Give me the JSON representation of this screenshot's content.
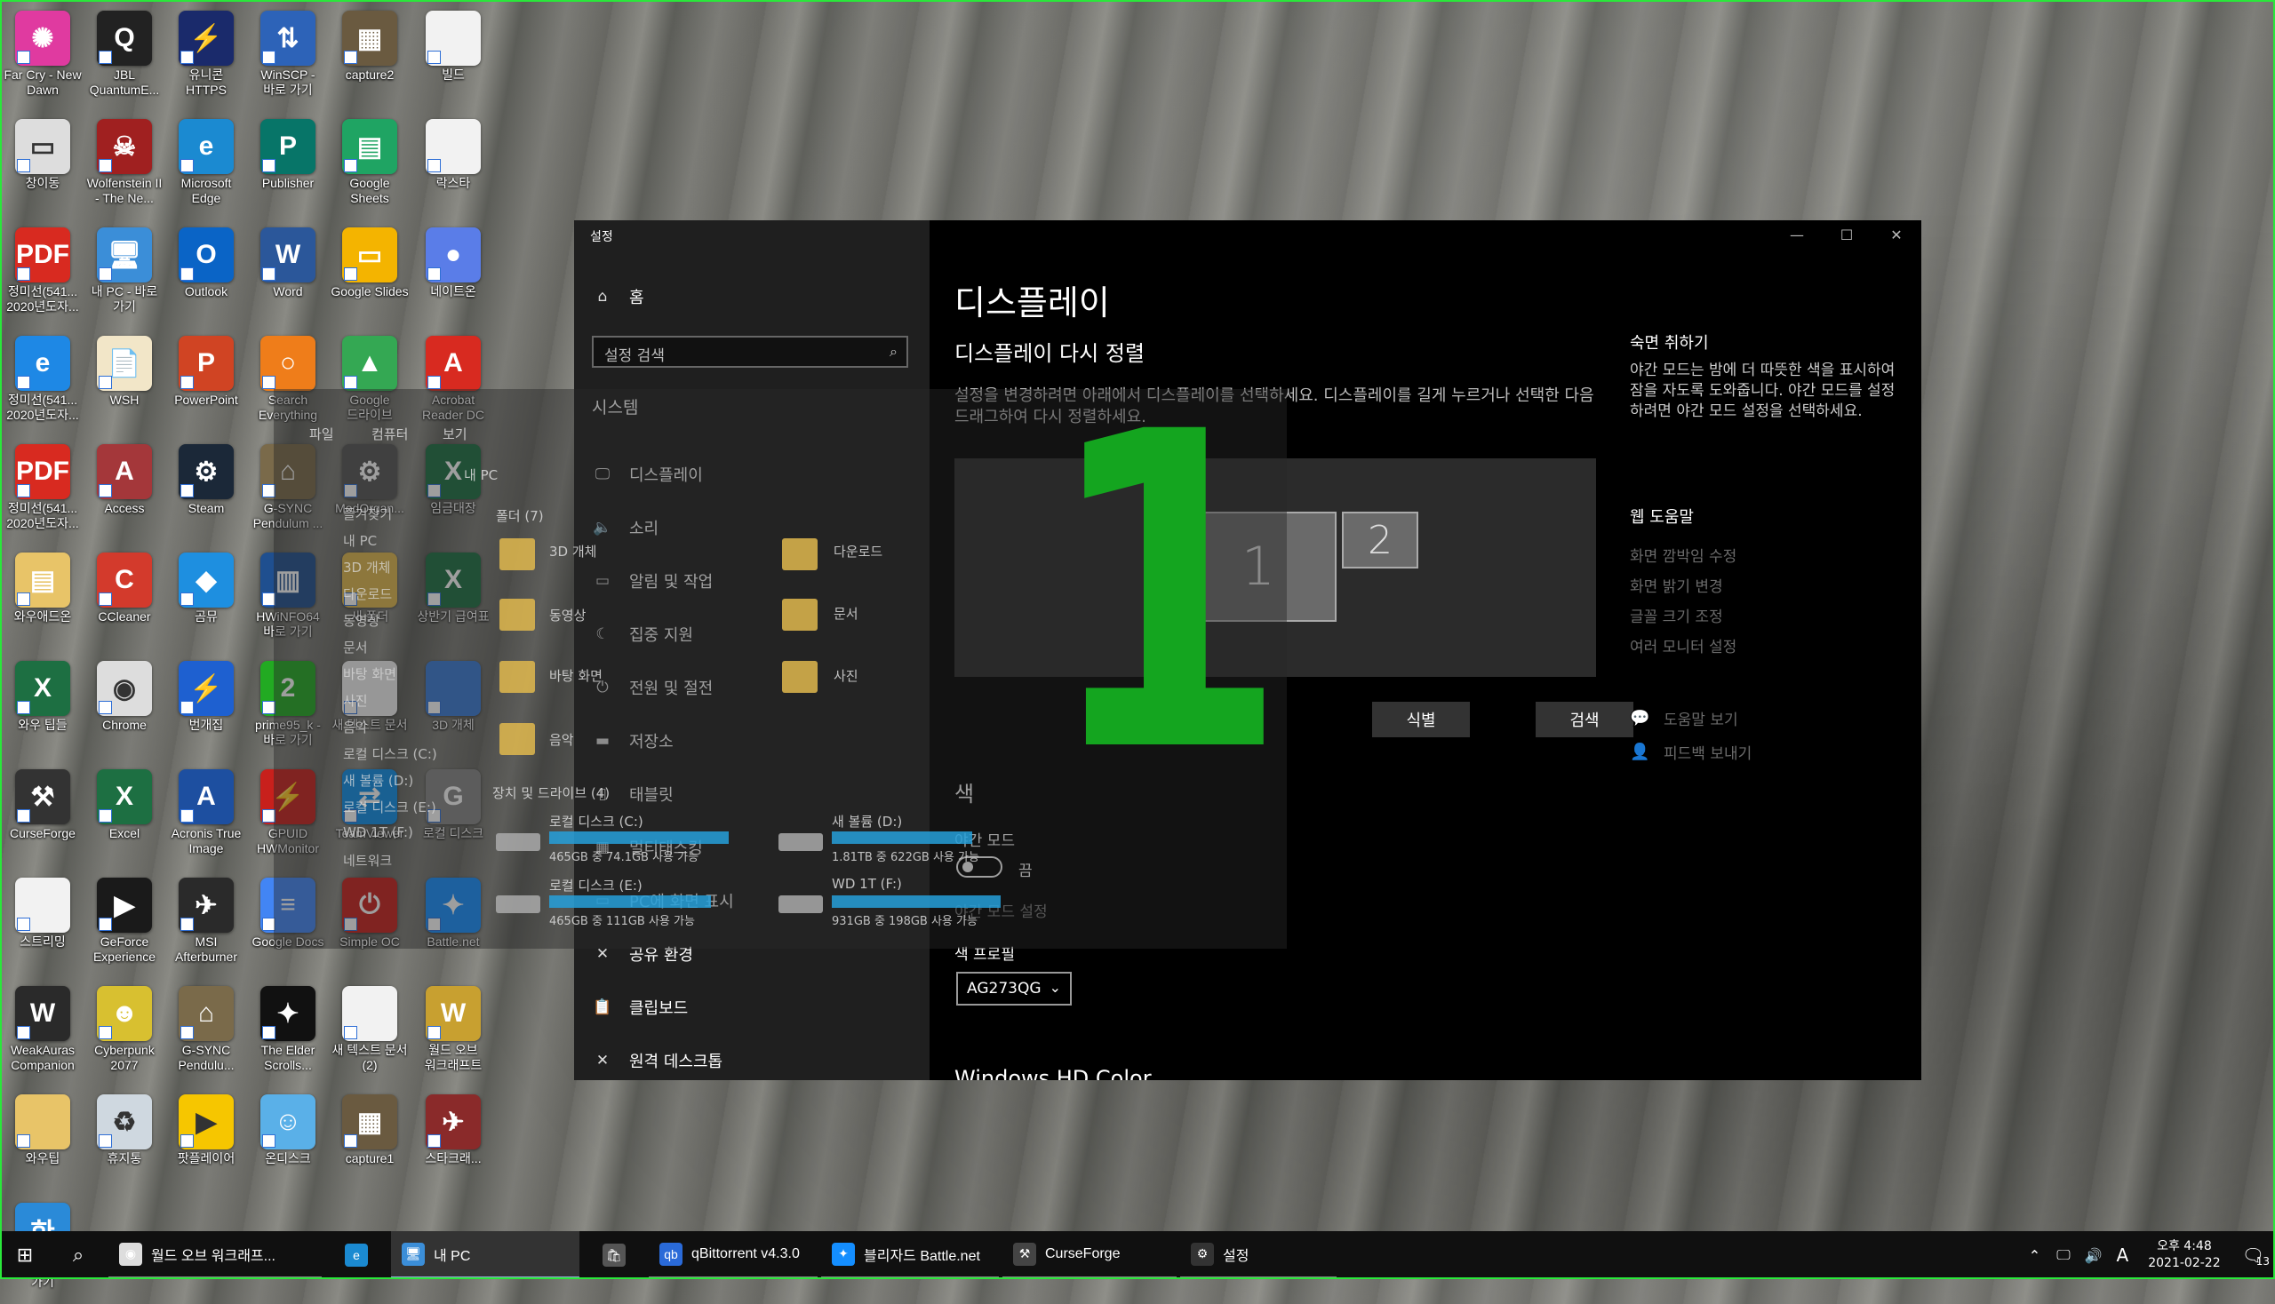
{
  "desktop_icons": [
    {
      "label": "Far Cry - New Dawn",
      "color": "#e03aa0",
      "glyph": "✺"
    },
    {
      "label": "JBL QuantumE...",
      "color": "#222222",
      "glyph": "Q"
    },
    {
      "label": "유니콘 HTTPS",
      "color": "#1a2a6b",
      "glyph": "⚡"
    },
    {
      "label": "WinSCP - 바로 가기",
      "color": "#2d63b8",
      "glyph": "⇅"
    },
    {
      "label": "capture2",
      "color": "#6a5a40",
      "glyph": "▦"
    },
    {
      "label": "빌드",
      "color": "#f2f2f2",
      "glyph": ""
    },
    {
      "label": "창이동",
      "color": "#dddddd",
      "glyph": "▭"
    },
    {
      "label": "Wolfenstein II - The Ne...",
      "color": "#a02020",
      "glyph": "☠"
    },
    {
      "label": "Microsoft Edge",
      "color": "#1b8ad1",
      "glyph": "e"
    },
    {
      "label": "Publisher",
      "color": "#077568",
      "glyph": "P"
    },
    {
      "label": "Google Sheets",
      "color": "#1fa463",
      "glyph": "▤"
    },
    {
      "label": "락스타",
      "color": "#f2f2f2",
      "glyph": ""
    },
    {
      "label": "정미선(541... 2020년도자...",
      "color": "#d82a20",
      "glyph": "PDF"
    },
    {
      "label": "내 PC - 바로 가기",
      "color": "#3b8ed8",
      "glyph": "🖥"
    },
    {
      "label": "Outlook",
      "color": "#0a64c6",
      "glyph": "O"
    },
    {
      "label": "Word",
      "color": "#2b579a",
      "glyph": "W"
    },
    {
      "label": "Google Slides",
      "color": "#f4b400",
      "glyph": "▭"
    },
    {
      "label": "네이트온",
      "color": "#5a7de8",
      "glyph": "●"
    },
    {
      "label": "정미선(541... 2020년도자...",
      "color": "#1e88e5",
      "glyph": "e"
    },
    {
      "label": "WSH",
      "color": "#f2e6c8",
      "glyph": "📄"
    },
    {
      "label": "PowerPoint",
      "color": "#d04423",
      "glyph": "P"
    },
    {
      "label": "Search Everything",
      "color": "#ef7d1a",
      "glyph": "○"
    },
    {
      "label": "Google 드라이브",
      "color": "#34a853",
      "glyph": "▲"
    },
    {
      "label": "Acrobat Reader DC",
      "color": "#d82a20",
      "glyph": "A"
    },
    {
      "label": "정미선(541... 2020년도자...",
      "color": "#d82a20",
      "glyph": "PDF"
    },
    {
      "label": "Access",
      "color": "#a4373a",
      "glyph": "A"
    },
    {
      "label": "Steam",
      "color": "#1b2838",
      "glyph": "⚙"
    },
    {
      "label": "G-SYNC Pendulum ...",
      "color": "#7a6a4a",
      "glyph": "⌂"
    },
    {
      "label": "ModOrgan...",
      "color": "#555555",
      "glyph": "⚙"
    },
    {
      "label": "임금대장",
      "color": "#1d6f42",
      "glyph": "X"
    },
    {
      "label": "와우애드온",
      "color": "#e8c468",
      "glyph": "▤"
    },
    {
      "label": "CCleaner",
      "color": "#d33a2c",
      "glyph": "C"
    },
    {
      "label": "곰뮤",
      "color": "#1e8fe0",
      "glyph": "◆"
    },
    {
      "label": "HWiNFO64 바로 가기",
      "color": "#1f4f8f",
      "glyph": "▥"
    },
    {
      "label": "새 폴더",
      "color": "#e0b94e",
      "glyph": ""
    },
    {
      "label": "상반기 급여표",
      "color": "#1d6f42",
      "glyph": "X"
    },
    {
      "label": "와우 팁들",
      "color": "#1d6f42",
      "glyph": "X"
    },
    {
      "label": "Chrome",
      "color": "#dddddd",
      "glyph": "◉"
    },
    {
      "label": "번개집",
      "color": "#1e60d0",
      "glyph": "⚡"
    },
    {
      "label": "prime95_k - 바로 가기",
      "color": "#22aa22",
      "glyph": "2"
    },
    {
      "label": "새 텍스트 문서",
      "color": "#f2f2f2",
      "glyph": ""
    },
    {
      "label": "3D 개체",
      "color": "#3a7bd5",
      "glyph": ""
    },
    {
      "label": "CurseForge",
      "color": "#333333",
      "glyph": "⚒"
    },
    {
      "label": "Excel",
      "color": "#1d6f42",
      "glyph": "X"
    },
    {
      "label": "Acronis True Image",
      "color": "#1d4fa0",
      "glyph": "A"
    },
    {
      "label": "GPUID HWMonitor",
      "color": "#c8201c",
      "glyph": "⚡"
    },
    {
      "label": "TeamViewer",
      "color": "#0e8ee9",
      "glyph": "⇄"
    },
    {
      "label": "로컬 디스크",
      "color": "#888888",
      "glyph": "G"
    },
    {
      "label": "스트리밍",
      "color": "#f2f2f2",
      "glyph": ""
    },
    {
      "label": "GeForce Experience",
      "color": "#1a1a1a",
      "glyph": "▶"
    },
    {
      "label": "MSI Afterburner",
      "color": "#2a2a2a",
      "glyph": "✈"
    },
    {
      "label": "Google Docs",
      "color": "#4285f4",
      "glyph": "≡"
    },
    {
      "label": "Simple OC",
      "color": "#c8201c",
      "glyph": "⏻"
    },
    {
      "label": "Battle.net",
      "color": "#148eff",
      "glyph": "✦"
    },
    {
      "label": "WeakAuras Companion",
      "color": "#2a2a2a",
      "glyph": "W"
    },
    {
      "label": "Cyberpunk 2077",
      "color": "#d8c030",
      "glyph": "☻"
    },
    {
      "label": "G-SYNC Pendulu...",
      "color": "#7a6a4a",
      "glyph": "⌂"
    },
    {
      "label": "The Elder Scrolls...",
      "color": "#111111",
      "glyph": "✦"
    },
    {
      "label": "새 텍스트 문서 (2)",
      "color": "#f2f2f2",
      "glyph": ""
    },
    {
      "label": "월드 오브 워크래프트",
      "color": "#c8a030",
      "glyph": "W"
    },
    {
      "label": "와우팁",
      "color": "#e8c468",
      "glyph": ""
    },
    {
      "label": "휴지통",
      "color": "#cfd8e0",
      "glyph": "♻"
    },
    {
      "label": "팟플레이어",
      "color": "#f6c600",
      "glyph": "▶"
    },
    {
      "label": "온디스크",
      "color": "#5ab0e8",
      "glyph": "☺"
    },
    {
      "label": "capture1",
      "color": "#6a5a40",
      "glyph": "▦"
    },
    {
      "label": "스타크래...",
      "color": "#8a2a2a",
      "glyph": "✈"
    },
    {
      "label": "Hwp - 바로 가기",
      "color": "#2a8ad8",
      "glyph": "한"
    }
  ],
  "settings": {
    "window_title": "설정",
    "win_minimize": "—",
    "win_maximize": "☐",
    "win_close": "✕",
    "home_label": "홈",
    "home_icon": "home-icon",
    "search_placeholder": "설정 검색",
    "section_label": "시스템",
    "nav": [
      {
        "label": "디스플레이",
        "icon": "🖵"
      },
      {
        "label": "소리",
        "icon": "🔈"
      },
      {
        "label": "알림 및 작업",
        "icon": "▭"
      },
      {
        "label": "집중 지원",
        "icon": "☾"
      },
      {
        "label": "전원 및 절전",
        "icon": "⏻"
      },
      {
        "label": "저장소",
        "icon": "▬"
      },
      {
        "label": "태블릿",
        "icon": "▯"
      },
      {
        "label": "멀티태스킹",
        "icon": "▦"
      },
      {
        "label": "PC에 화면 표시",
        "icon": "▭"
      },
      {
        "label": "공유 환경",
        "icon": "✕"
      },
      {
        "label": "클립보드",
        "icon": "📋"
      },
      {
        "label": "원격 데스크톱",
        "icon": "✕"
      }
    ],
    "page_title": "디스플레이",
    "rearrange_heading": "디스플레이 다시 정렬",
    "rearrange_instructions": "설정을 변경하려면 아래에서 디스플레이를 선택하세요. 디스플레이를 길게 누르거나 선택한 다음 드래그하여 다시 정렬하세요.",
    "monitor_1": "1",
    "monitor_2": "2",
    "identify_button": "식별",
    "detect_button": "검색",
    "color_heading": "색",
    "night_light_label": "야간 모드",
    "night_light_state": "끔",
    "night_light_settings": "야간 모드 설정",
    "color_profile_label": "색 프로필",
    "color_profile_value": "AG273QG",
    "hdr_heading": "Windows HD Color",
    "sleep_title": "숙면 취하기",
    "sleep_desc": "야간 모드는 밤에 더 따뜻한 색을 표시하여 잠을 자도록 도와줍니다. 야간 모드를 설정하려면 야간 모드 설정을 선택하세요.",
    "web_help_title": "웹 도움말",
    "web_help_links": [
      "화면 깜박임 수정",
      "화면 밝기 변경",
      "글꼴 크기 조정",
      "여러 모니터 설정"
    ],
    "get_help": "도움말 보기",
    "give_feedback": "피드백 보내기"
  },
  "overlay_number": "1",
  "explorer_ghost": {
    "tabs": [
      "파일",
      "컴퓨터",
      "보기"
    ],
    "path": "내 PC",
    "folders_header": "폴더 (7)",
    "folders": [
      "3D 개체",
      "다운로드",
      "동영상",
      "문서",
      "바탕 화면",
      "사진",
      "음악"
    ],
    "drives_header": "장치 및 드라이브 (4)",
    "drives": [
      {
        "name": "로컬 디스크 (C:)",
        "info": "465GB 중 74.1GB 사용 가능",
        "fill": 0.84
      },
      {
        "name": "새 볼륨 (D:)",
        "info": "1.81TB 중 622GB 사용 가능",
        "fill": 0.66
      },
      {
        "name": "로컬 디스크 (E:)",
        "info": "465GB 중 111GB 사용 가능",
        "fill": 0.76
      },
      {
        "name": "WD 1T (F:)",
        "info": "931GB 중 198GB 사용 가능",
        "fill": 0.79
      }
    ],
    "sidebar": [
      "즐겨찾기",
      "내 PC",
      "3D 개체",
      "다운로드",
      "동영상",
      "문서",
      "바탕 화면",
      "사진",
      "음악",
      "로컬 디스크 (C:)",
      "새 볼륨 (D:)",
      "로컬 디스크 (E:)",
      "WD 1T (F:)",
      "네트워크"
    ]
  },
  "taskbar": {
    "items": [
      {
        "label": "월드 오브 워크래프...",
        "color": "#dddddd",
        "glyph": "◉"
      },
      {
        "label": "",
        "color": "#1b8ad1",
        "glyph": "e"
      },
      {
        "label": "내 PC",
        "color": "#3b8ed8",
        "glyph": "🖥"
      },
      {
        "label": "",
        "color": "#555555",
        "glyph": "🛍"
      },
      {
        "label": "qBittorrent v4.3.0",
        "color": "#2a6ad8",
        "glyph": "qb"
      },
      {
        "label": "블리자드 Battle.net",
        "color": "#148eff",
        "glyph": "✦"
      },
      {
        "label": "CurseForge",
        "color": "#444444",
        "glyph": "⚒"
      },
      {
        "label": "설정",
        "color": "#333333",
        "glyph": "⚙"
      }
    ],
    "clock_time": "오후 4:48",
    "clock_date": "2021-02-22",
    "ime": "A",
    "notif_count": "13"
  }
}
